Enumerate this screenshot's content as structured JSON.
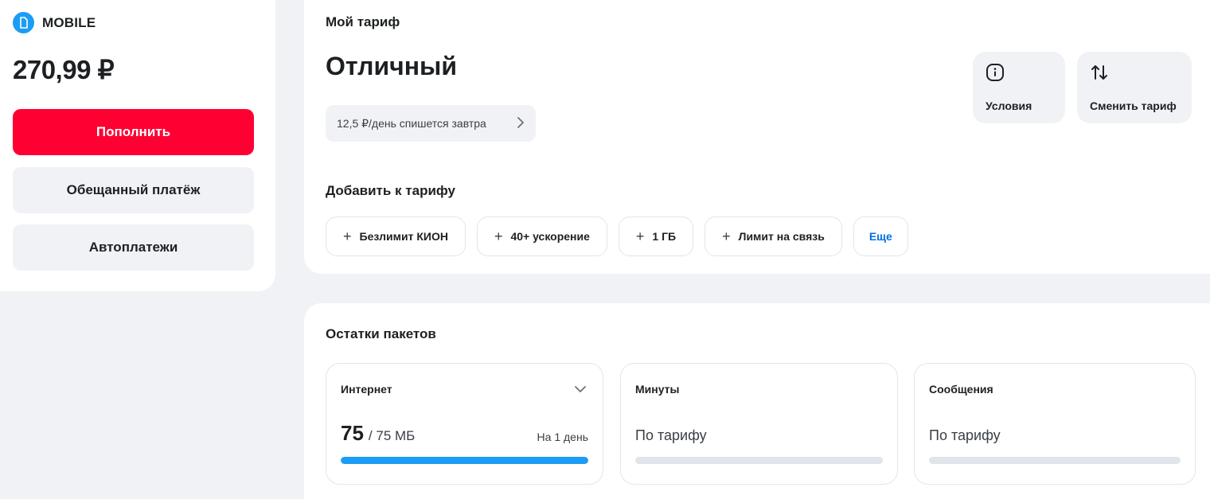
{
  "balance": {
    "brand": "MOBILE",
    "amount": "270,99 ₽",
    "topup_label": "Пополнить",
    "promised_payment_label": "Обещанный платёж",
    "autopay_label": "Автоплатежи"
  },
  "tariff": {
    "section_label": "Мой тариф",
    "name": "Отличный",
    "daily_charge": "12,5 ₽/день спишется завтра",
    "terms_label": "Условия",
    "change_label": "Сменить тариф",
    "add_label": "Добавить к тарифу",
    "addons": [
      "Безлимит КИОН",
      "40+ ускорение",
      "1 ГБ",
      "Лимит на связь"
    ],
    "more_label": "Еще"
  },
  "packages": {
    "section_label": "Остатки пакетов",
    "internet": {
      "title": "Интернет",
      "remaining": "75",
      "total": "/ 75 МБ",
      "period": "На 1 день",
      "fill_fraction": 1.0
    },
    "minutes": {
      "title": "Минуты",
      "status": "По тарифу"
    },
    "sms": {
      "title": "Сообщения",
      "status": "По тарифу"
    }
  },
  "colors": {
    "accent_red": "#ff0032",
    "accent_blue": "#1b9cf5",
    "link_blue": "#0070e5"
  }
}
